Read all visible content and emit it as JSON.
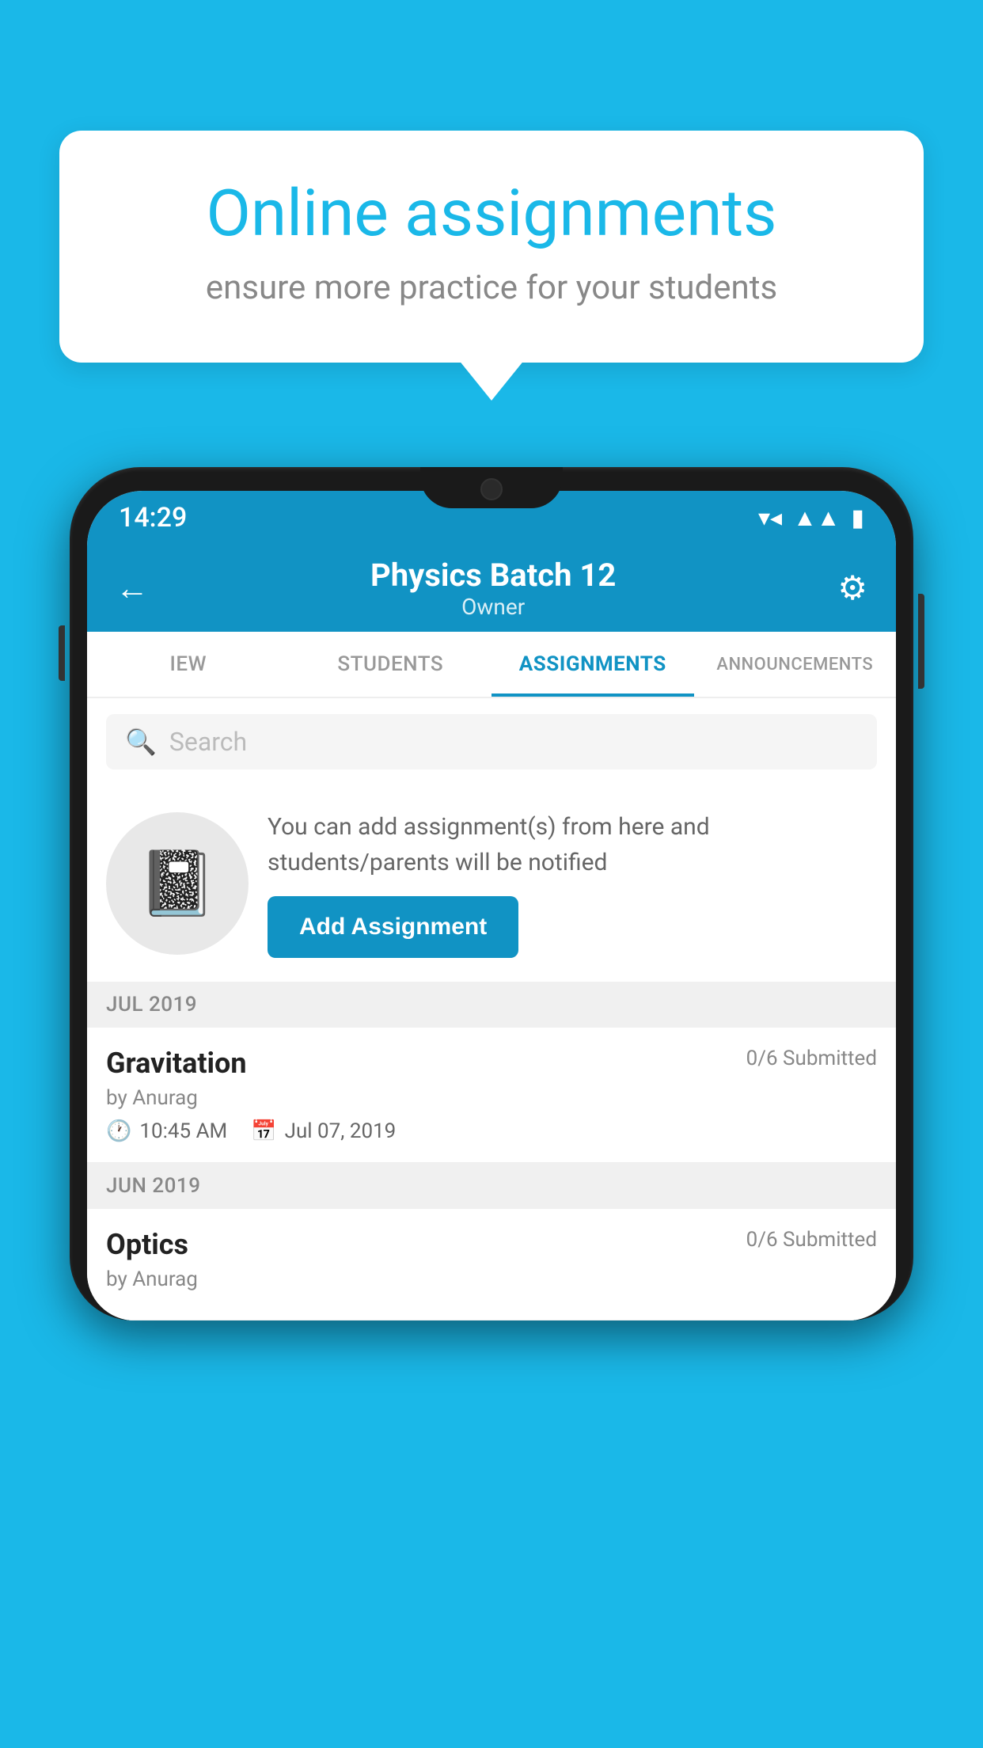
{
  "background_color": "#1ab8e8",
  "speech_bubble": {
    "title": "Online assignments",
    "subtitle": "ensure more practice for your students"
  },
  "status_bar": {
    "time": "14:29",
    "icons": [
      "wifi",
      "signal",
      "battery"
    ]
  },
  "app_bar": {
    "title": "Physics Batch 12",
    "subtitle": "Owner",
    "back_label": "←",
    "settings_label": "⚙"
  },
  "tabs": [
    {
      "label": "IEW",
      "active": false
    },
    {
      "label": "STUDENTS",
      "active": false
    },
    {
      "label": "ASSIGNMENTS",
      "active": true
    },
    {
      "label": "ANNOUNCEMENTS",
      "active": false
    }
  ],
  "search": {
    "placeholder": "Search"
  },
  "info_section": {
    "description": "You can add assignment(s) from here and students/parents will be notified",
    "add_button_label": "Add Assignment"
  },
  "sections": [
    {
      "month_label": "JUL 2019",
      "assignments": [
        {
          "title": "Gravitation",
          "submitted": "0/6 Submitted",
          "by": "by Anurag",
          "time": "10:45 AM",
          "date": "Jul 07, 2019"
        }
      ]
    },
    {
      "month_label": "JUN 2019",
      "assignments": [
        {
          "title": "Optics",
          "submitted": "0/6 Submitted",
          "by": "by Anurag",
          "time": "",
          "date": ""
        }
      ]
    }
  ]
}
